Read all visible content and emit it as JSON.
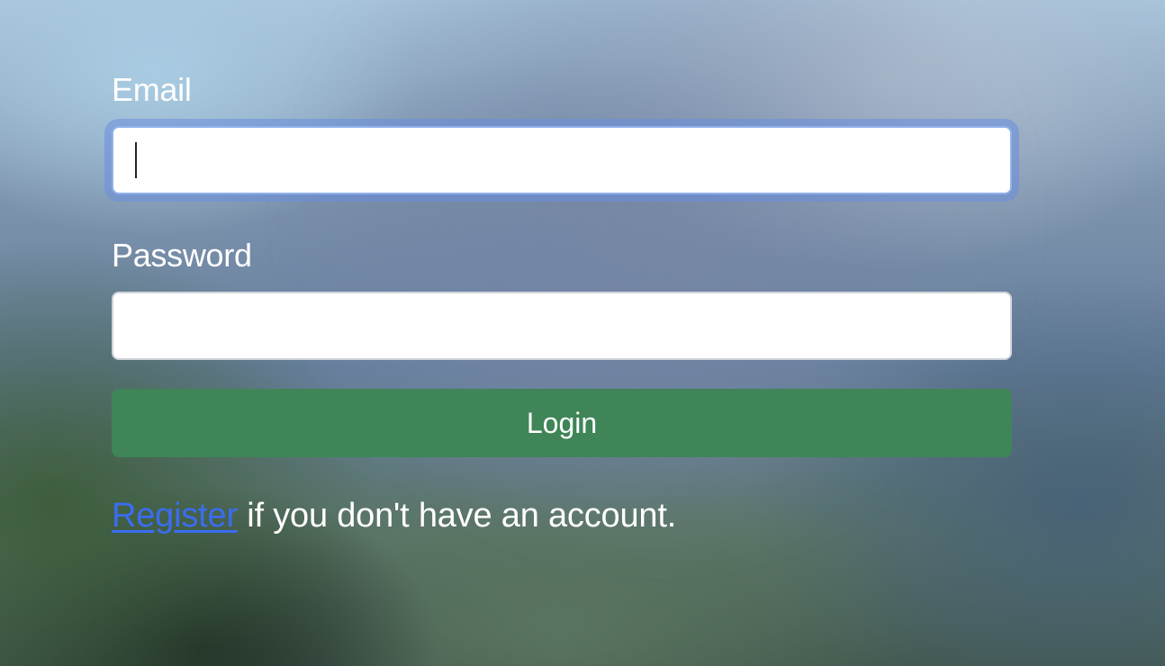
{
  "form": {
    "email_label": "Email",
    "email_value": "",
    "password_label": "Password",
    "password_value": "",
    "login_label": "Login",
    "register_link": "Register",
    "register_suffix": " if you don't have an account."
  },
  "colors": {
    "login_button": "#3f8557",
    "link": "#3a6df0",
    "focus_ring": "#6a8edc"
  }
}
